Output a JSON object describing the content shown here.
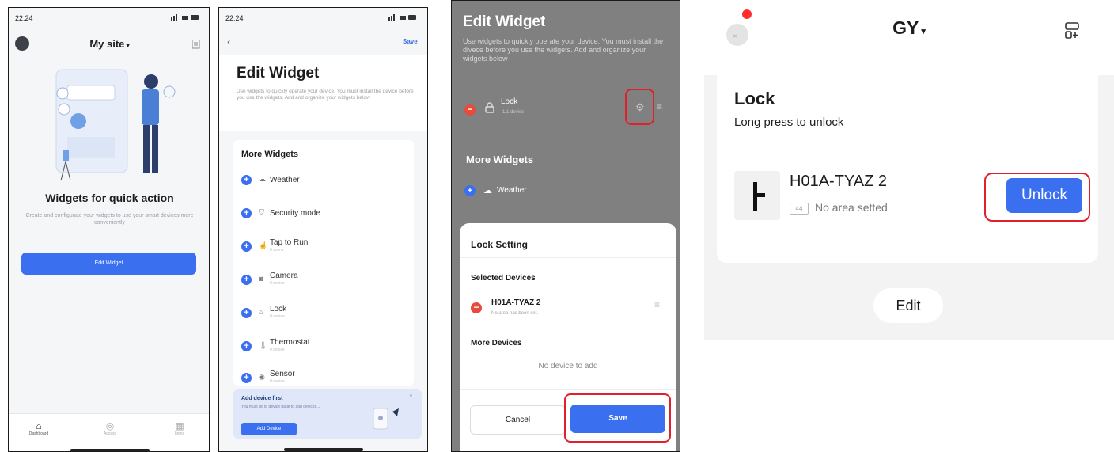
{
  "panel1": {
    "status_time": "22:24",
    "title": "My site",
    "headline": "Widgets for quick action",
    "description": "Create and configurate your widgets to use your smart devices more conveniently",
    "edit_button": "Edit Widget",
    "tabs": [
      {
        "label": "Dashboard"
      },
      {
        "label": "Access"
      },
      {
        "label": "Items"
      }
    ]
  },
  "panel2": {
    "status_time": "22:24",
    "save_label": "Save",
    "title": "Edit Widget",
    "description": "Use widgets to quickly operate your device. You must install the device before you use the widgets. Add and organize your widgets below",
    "section_title": "More Widgets",
    "items": [
      {
        "label": "Weather",
        "sub": ""
      },
      {
        "label": "Security mode",
        "sub": ""
      },
      {
        "label": "Tap to Run",
        "sub": "0 scene"
      },
      {
        "label": "Camera",
        "sub": "0 device"
      },
      {
        "label": "Lock",
        "sub": "0 device"
      },
      {
        "label": "Thermostat",
        "sub": "0 device"
      },
      {
        "label": "Sensor",
        "sub": "0 device"
      }
    ],
    "banner": {
      "title": "Add device first",
      "text": "You must go to device page to add devices...",
      "button": "Add Device"
    }
  },
  "panel3": {
    "title": "Edit Widget",
    "description": "Use widgets to quickly operate your device. You must install the divece before you use the widgets. Add and organize your widgets below",
    "lock_label": "Lock",
    "lock_sub": "1/1 device",
    "section_title": "More Widgets",
    "weather_label": "Weather",
    "sheet": {
      "title": "Lock Setting",
      "selected_title": "Selected Devices",
      "device_name": "H01A-TYAZ 2",
      "device_sub": "No area has been set.",
      "more_title": "More Devices",
      "empty_text": "No device to add",
      "cancel": "Cancel",
      "save": "Save"
    }
  },
  "panel4": {
    "site_name": "GY",
    "card_title": "Lock",
    "card_subtitle": "Long press to unlock",
    "device_name": "H01A-TYAZ 2",
    "area_badge": "44",
    "area_text": "No area setted",
    "unlock_button": "Unlock",
    "edit_button": "Edit"
  },
  "colors": {
    "accent": "#3a6ff0",
    "highlight": "#e0202a",
    "danger": "#e84a3c"
  }
}
